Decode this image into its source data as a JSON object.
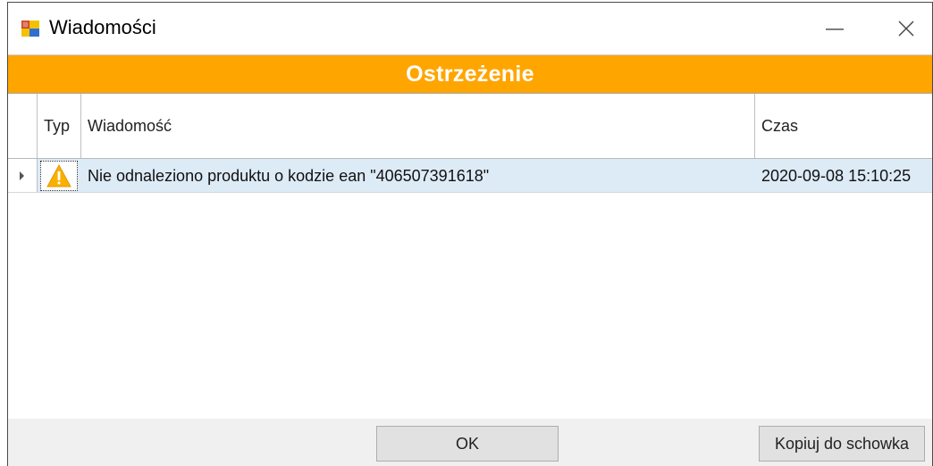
{
  "window": {
    "title": "Wiadomości",
    "minimize_glyph": "—",
    "banner": "Ostrzeżenie"
  },
  "grid": {
    "columns": [
      "Typ",
      "Wiadomość",
      "Czas"
    ],
    "rows": [
      {
        "type_icon": "warning-icon",
        "message": "Nie odnaleziono produktu o kodzie ean \"406507391618\"",
        "time": "2020-09-08 15:10:25"
      }
    ]
  },
  "buttons": {
    "ok": "OK",
    "copy": "Kopiuj do schowka"
  },
  "colors": {
    "banner": "#ffa500",
    "selected_row": "#ddebf7",
    "warning": "#f9b000"
  }
}
